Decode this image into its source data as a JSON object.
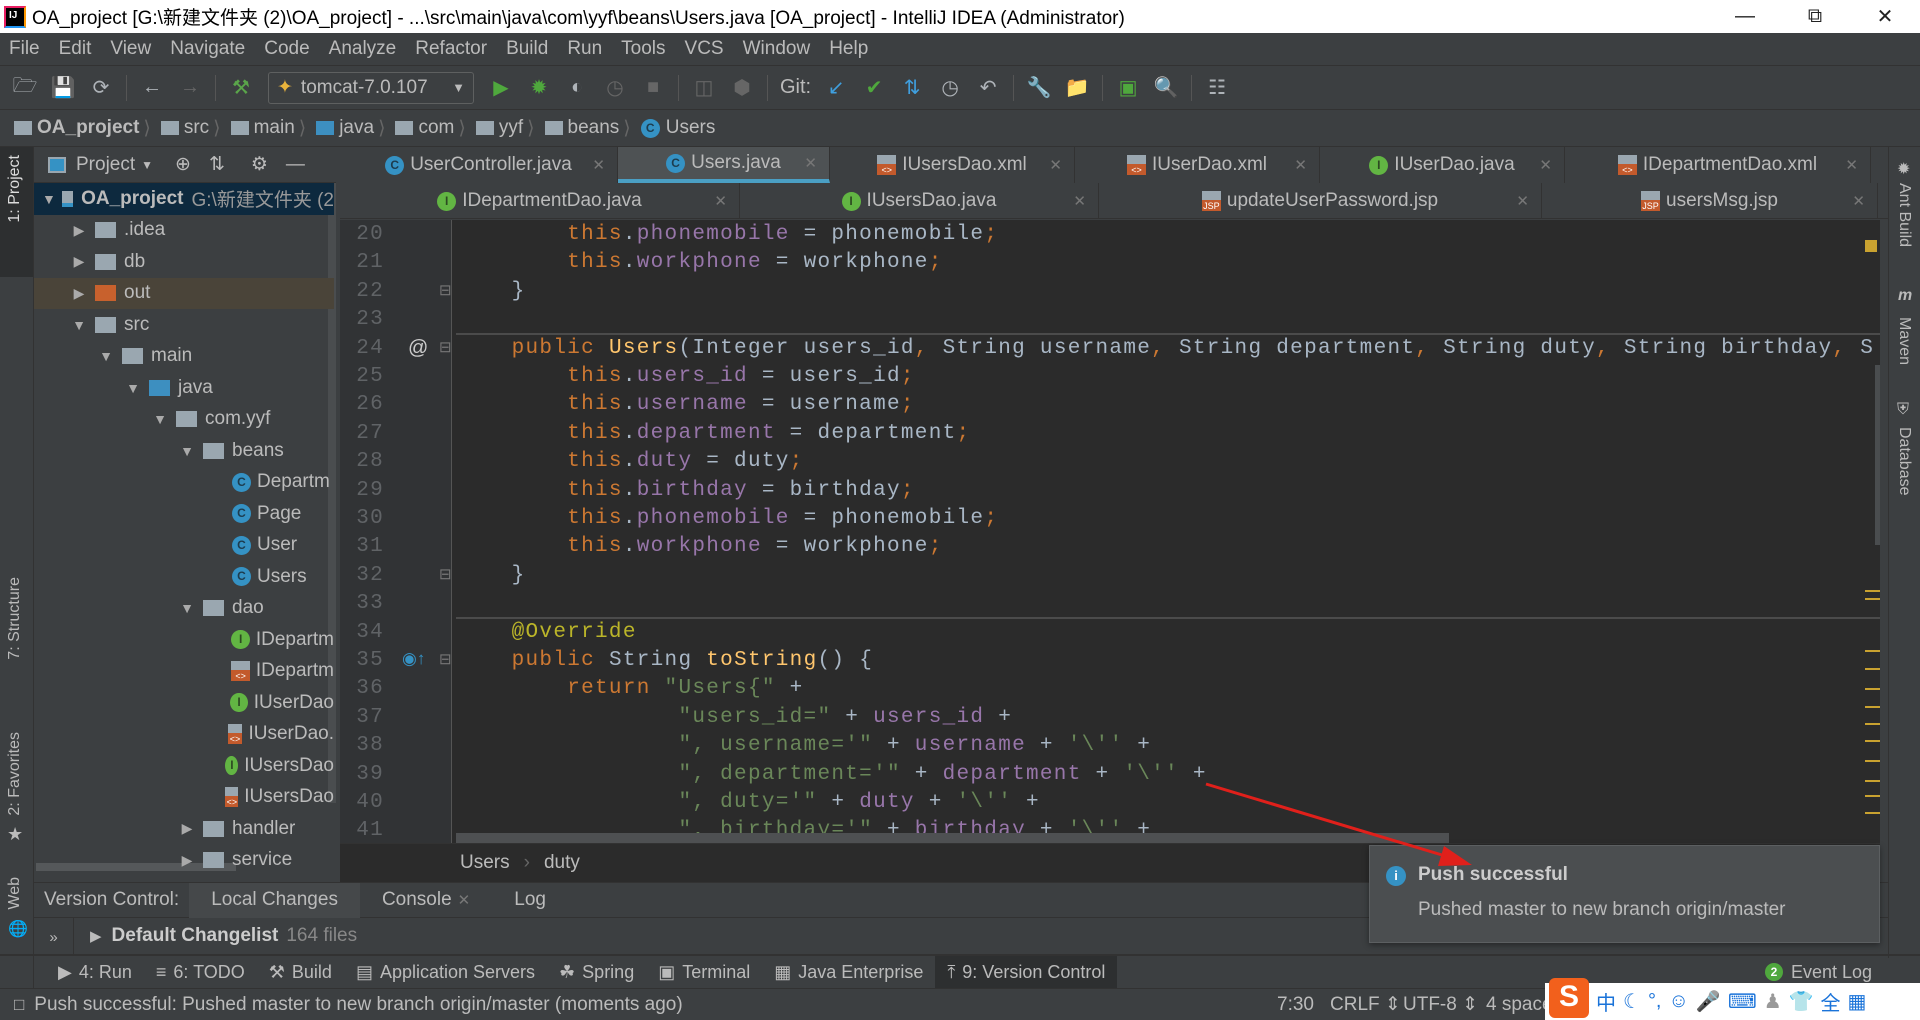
{
  "window": {
    "title": "OA_project [G:\\新建文件夹 (2)\\OA_project] - ...\\src\\main\\java\\com\\yyf\\beans\\Users.java [OA_project] - IntelliJ IDEA (Administrator)"
  },
  "menu": [
    "File",
    "Edit",
    "View",
    "Navigate",
    "Code",
    "Analyze",
    "Refactor",
    "Build",
    "Run",
    "Tools",
    "VCS",
    "Window",
    "Help"
  ],
  "toolbar": {
    "run_config": "tomcat-7.0.107",
    "git_label": "Git:"
  },
  "navbar": [
    {
      "label": "OA_project",
      "kind": "project"
    },
    {
      "label": "src",
      "kind": "folder"
    },
    {
      "label": "main",
      "kind": "folder"
    },
    {
      "label": "java",
      "kind": "src"
    },
    {
      "label": "com",
      "kind": "package"
    },
    {
      "label": "yyf",
      "kind": "package"
    },
    {
      "label": "beans",
      "kind": "package"
    },
    {
      "label": "Users",
      "kind": "class"
    }
  ],
  "left_stripe": [
    "1: Project",
    "7: Structure",
    "2: Favorites",
    "Web"
  ],
  "right_stripe": [
    "Ant Build",
    "Maven",
    "Database"
  ],
  "project_panel": {
    "title": "Project"
  },
  "tree": [
    {
      "label": "OA_project",
      "hint": "G:\\新建文件夹 (2",
      "level": 0,
      "arrow": "open",
      "icon": "project",
      "selected": true
    },
    {
      "label": ".idea",
      "level": 1,
      "arrow": "closed",
      "icon": "folder"
    },
    {
      "label": "db",
      "level": 1,
      "arrow": "closed",
      "icon": "folder"
    },
    {
      "label": "out",
      "level": 1,
      "arrow": "closed",
      "icon": "excluded",
      "highlight": true
    },
    {
      "label": "src",
      "level": 1,
      "arrow": "open",
      "icon": "folder"
    },
    {
      "label": "main",
      "level": 2,
      "arrow": "open",
      "icon": "folder"
    },
    {
      "label": "java",
      "level": 3,
      "arrow": "open",
      "icon": "src"
    },
    {
      "label": "com.yyf",
      "level": 4,
      "arrow": "open",
      "icon": "package"
    },
    {
      "label": "beans",
      "level": 5,
      "arrow": "open",
      "icon": "package"
    },
    {
      "label": "Departm",
      "level": 6,
      "icon": "class"
    },
    {
      "label": "Page",
      "level": 6,
      "icon": "class"
    },
    {
      "label": "User",
      "level": 6,
      "icon": "class"
    },
    {
      "label": "Users",
      "level": 6,
      "icon": "class"
    },
    {
      "label": "dao",
      "level": 5,
      "arrow": "open",
      "icon": "package"
    },
    {
      "label": "IDepartm",
      "level": 6,
      "icon": "interface"
    },
    {
      "label": "IDepartm",
      "level": 6,
      "icon": "xml"
    },
    {
      "label": "IUserDao",
      "level": 6,
      "icon": "interface"
    },
    {
      "label": "IUserDao.",
      "level": 6,
      "icon": "xml"
    },
    {
      "label": "IUsersDao",
      "level": 6,
      "icon": "interface"
    },
    {
      "label": "IUsersDao",
      "level": 6,
      "icon": "xml"
    },
    {
      "label": "handler",
      "level": 5,
      "arrow": "closed",
      "icon": "package"
    },
    {
      "label": "service",
      "level": 5,
      "arrow": "closed",
      "icon": "package"
    }
  ],
  "tabs_row1": [
    {
      "label": "UserController.java",
      "icon": "class"
    },
    {
      "label": "Users.java",
      "icon": "class",
      "active": true
    },
    {
      "label": "IUsersDao.xml",
      "icon": "xml"
    },
    {
      "label": "IUserDao.xml",
      "icon": "xml"
    },
    {
      "label": "IUserDao.java",
      "icon": "interface"
    },
    {
      "label": "IDepartmentDao.xml",
      "icon": "xml"
    }
  ],
  "tabs_row2": [
    {
      "label": "IDepartmentDao.java",
      "icon": "interface"
    },
    {
      "label": "IUsersDao.java",
      "icon": "interface"
    },
    {
      "label": "updateUserPassword.jsp",
      "icon": "jsp"
    },
    {
      "label": "usersMsg.jsp",
      "icon": "jsp"
    }
  ],
  "code": [
    {
      "n": "20",
      "t": [
        [
          "        ",
          "t"
        ],
        [
          "this",
          "k"
        ],
        [
          ".",
          "t"
        ],
        [
          "phonemobile",
          "f"
        ],
        [
          " = phonemobile",
          "t"
        ],
        [
          ";",
          "k"
        ]
      ]
    },
    {
      "n": "21",
      "t": [
        [
          "        ",
          "t"
        ],
        [
          "this",
          "k"
        ],
        [
          ".",
          "t"
        ],
        [
          "workphone",
          "f"
        ],
        [
          " = workphone",
          "t"
        ],
        [
          ";",
          "k"
        ]
      ]
    },
    {
      "n": "22",
      "t": [
        [
          "    }",
          "t"
        ]
      ],
      "fold": true
    },
    {
      "n": "23",
      "t": []
    },
    {
      "n": "24",
      "t": [
        [
          "    ",
          "t"
        ],
        [
          "public ",
          "k"
        ],
        [
          "Users",
          "m"
        ],
        [
          "(Integer users_id",
          "t"
        ],
        [
          ", ",
          "k"
        ],
        [
          "String username",
          "t"
        ],
        [
          ", ",
          "k"
        ],
        [
          "String department",
          "t"
        ],
        [
          ", ",
          "k"
        ],
        [
          "String duty",
          "t"
        ],
        [
          ", ",
          "k"
        ],
        [
          "String birthday",
          "t"
        ],
        [
          ", ",
          "k"
        ],
        [
          "S",
          "t"
        ]
      ],
      "fold": true,
      "sep": true,
      "mark": "@"
    },
    {
      "n": "25",
      "t": [
        [
          "        ",
          "t"
        ],
        [
          "this",
          "k"
        ],
        [
          ".",
          "t"
        ],
        [
          "users_id",
          "f"
        ],
        [
          " = users_id",
          "t"
        ],
        [
          ";",
          "k"
        ]
      ]
    },
    {
      "n": "26",
      "t": [
        [
          "        ",
          "t"
        ],
        [
          "this",
          "k"
        ],
        [
          ".",
          "t"
        ],
        [
          "username",
          "f"
        ],
        [
          " = username",
          "t"
        ],
        [
          ";",
          "k"
        ]
      ]
    },
    {
      "n": "27",
      "t": [
        [
          "        ",
          "t"
        ],
        [
          "this",
          "k"
        ],
        [
          ".",
          "t"
        ],
        [
          "department",
          "f"
        ],
        [
          " = department",
          "t"
        ],
        [
          ";",
          "k"
        ]
      ]
    },
    {
      "n": "28",
      "t": [
        [
          "        ",
          "t"
        ],
        [
          "this",
          "k"
        ],
        [
          ".",
          "t"
        ],
        [
          "duty",
          "f"
        ],
        [
          " = duty",
          "t"
        ],
        [
          ";",
          "k"
        ]
      ]
    },
    {
      "n": "29",
      "t": [
        [
          "        ",
          "t"
        ],
        [
          "this",
          "k"
        ],
        [
          ".",
          "t"
        ],
        [
          "birthday",
          "f"
        ],
        [
          " = birthday",
          "t"
        ],
        [
          ";",
          "k"
        ]
      ]
    },
    {
      "n": "30",
      "t": [
        [
          "        ",
          "t"
        ],
        [
          "this",
          "k"
        ],
        [
          ".",
          "t"
        ],
        [
          "phonemobile",
          "f"
        ],
        [
          " = phonemobile",
          "t"
        ],
        [
          ";",
          "k"
        ]
      ]
    },
    {
      "n": "31",
      "t": [
        [
          "        ",
          "t"
        ],
        [
          "this",
          "k"
        ],
        [
          ".",
          "t"
        ],
        [
          "workphone",
          "f"
        ],
        [
          " = workphone",
          "t"
        ],
        [
          ";",
          "k"
        ]
      ]
    },
    {
      "n": "32",
      "t": [
        [
          "    }",
          "t"
        ]
      ],
      "fold": true
    },
    {
      "n": "33",
      "t": []
    },
    {
      "n": "34",
      "t": [
        [
          "    ",
          "t"
        ],
        [
          "@Override",
          "a"
        ]
      ],
      "sep": true
    },
    {
      "n": "35",
      "t": [
        [
          "    ",
          "t"
        ],
        [
          "public ",
          "k"
        ],
        [
          "String ",
          "t"
        ],
        [
          "toString",
          "m"
        ],
        [
          "() {",
          "t"
        ]
      ],
      "fold": true,
      "mark": "override"
    },
    {
      "n": "36",
      "t": [
        [
          "        ",
          "t"
        ],
        [
          "return ",
          "k"
        ],
        [
          "\"Users{\"",
          "s"
        ],
        [
          " +",
          "t"
        ]
      ]
    },
    {
      "n": "37",
      "t": [
        [
          "                ",
          "t"
        ],
        [
          "\"users_id=\"",
          "s"
        ],
        [
          " + ",
          "t"
        ],
        [
          "users_id",
          "f"
        ],
        [
          " +",
          "t"
        ]
      ]
    },
    {
      "n": "38",
      "t": [
        [
          "                ",
          "t"
        ],
        [
          "\", username='\"",
          "s"
        ],
        [
          " + ",
          "t"
        ],
        [
          "username",
          "f"
        ],
        [
          " + ",
          "t"
        ],
        [
          "'\\''",
          "s"
        ],
        [
          " +",
          "t"
        ]
      ]
    },
    {
      "n": "39",
      "t": [
        [
          "                ",
          "t"
        ],
        [
          "\", department='\"",
          "s"
        ],
        [
          " + ",
          "t"
        ],
        [
          "department",
          "f"
        ],
        [
          " + ",
          "t"
        ],
        [
          "'\\''",
          "s"
        ],
        [
          " +",
          "t"
        ]
      ]
    },
    {
      "n": "40",
      "t": [
        [
          "                ",
          "t"
        ],
        [
          "\", duty='\"",
          "s"
        ],
        [
          " + ",
          "t"
        ],
        [
          "duty",
          "f"
        ],
        [
          " + ",
          "t"
        ],
        [
          "'\\''",
          "s"
        ],
        [
          " +",
          "t"
        ]
      ]
    },
    {
      "n": "41",
      "t": [
        [
          "                ",
          "t"
        ],
        [
          "\", birthday='\"",
          "s"
        ],
        [
          " + ",
          "t"
        ],
        [
          "birthday",
          "f"
        ],
        [
          " + ",
          "t"
        ],
        [
          "'\\''",
          "s"
        ],
        [
          " +",
          "t"
        ]
      ]
    }
  ],
  "editor_breadcrumb": [
    "Users",
    "duty"
  ],
  "version_control": {
    "label": "Version Control:",
    "tabs": [
      "Local Changes",
      "Console",
      "Log"
    ],
    "changelist": "Default Changelist",
    "file_count": "164 files"
  },
  "tool_windows": [
    {
      "label": "4: Run",
      "icon": "run"
    },
    {
      "label": "6: TODO",
      "icon": "todo"
    },
    {
      "label": "Build",
      "icon": "hammer"
    },
    {
      "label": "Application Servers",
      "icon": "servers"
    },
    {
      "label": "Spring",
      "icon": "leaf"
    },
    {
      "label": "Terminal",
      "icon": "terminal"
    },
    {
      "label": "Java Enterprise",
      "icon": "javaee"
    },
    {
      "label": "9: Version Control",
      "icon": "vcs",
      "active": true
    }
  ],
  "event_log": {
    "label": "Event Log",
    "badge": "2"
  },
  "status": {
    "message": "Push successful: Pushed master to new branch origin/master (moments ago)",
    "position": "7:30",
    "line_sep": "CRLF",
    "encoding": "UTF-8",
    "indent": "4 spaces"
  },
  "notification": {
    "title": "Push successful",
    "body": "Pushed master to new branch origin/master"
  },
  "ime": {
    "lang": "中",
    "width": "全"
  },
  "colors": {
    "accent": "#4a9fc4",
    "arrow": "#e0201b",
    "keyword": "#cc7832",
    "field": "#9876aa",
    "string": "#6a8759"
  }
}
